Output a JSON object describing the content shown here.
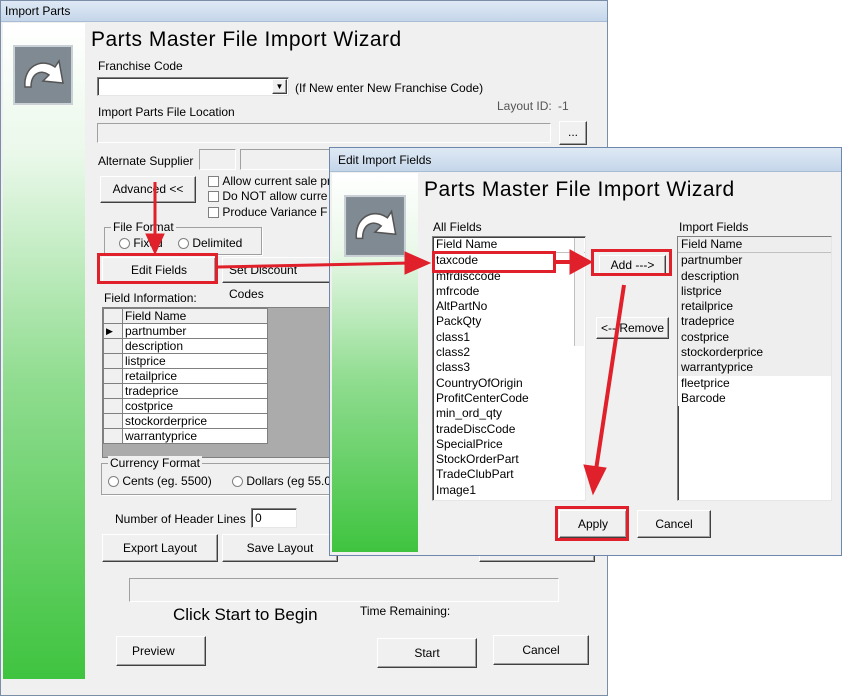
{
  "main": {
    "title": "Import Parts",
    "heading": "Parts Master File Import Wizard",
    "franchise_label": "Franchise Code",
    "franchise_hint": "(If New enter New Franchise Code)",
    "location_label": "Import Parts File Location",
    "layout_id_label": "Layout ID:",
    "layout_id_value": "-1",
    "browse_label": "...",
    "alt_supplier_label": "Alternate Supplier",
    "advanced_label": "Advanced <<",
    "checks": [
      "Allow current sale pr",
      "Do NOT allow curre",
      "Produce Variance F"
    ],
    "file_format_label": "File Format",
    "fixed_label": "Fixed",
    "delimited_label": "Delimited",
    "edit_fields_label": "Edit Fields",
    "set_discount_label": "Set Discount Codes",
    "field_info_label": "Field Information:",
    "grid_header": "Field Name",
    "grid_rows": [
      "partnumber",
      "description",
      "listprice",
      "retailprice",
      "tradeprice",
      "costprice",
      "stockorderprice",
      "warrantyprice"
    ],
    "currency_label": "Currency Format",
    "cents_label": "Cents (eg. 5500)",
    "dollars_label": "Dollars (eg 55.0",
    "header_lines_label": "Number of Header Lines",
    "header_lines_value": "0",
    "export_label": "Export Layout",
    "save_label": "Save Layout",
    "click_start": "Click Start to Begin",
    "time_remaining": "Time Remaining:",
    "preview_label": "Preview",
    "start_label": "Start",
    "cancel_label": "Cancel"
  },
  "dialog": {
    "title": "Edit Import Fields",
    "heading": "Parts Master File Import Wizard",
    "all_fields_label": "All Fields",
    "import_fields_label": "Import Fields",
    "list_header": "Field Name",
    "all_fields": [
      "taxcode",
      "mfrdisccode",
      "mfrcode",
      "AltPartNo",
      "PackQty",
      "class1",
      "class2",
      "class3",
      "CountryOfOrigin",
      "ProfitCenterCode",
      "min_ord_qty",
      "tradeDiscCode",
      "SpecialPrice",
      "StockOrderPart",
      "TradeClubPart",
      "Image1"
    ],
    "import_fields": [
      "partnumber",
      "description",
      "listprice",
      "retailprice",
      "tradeprice",
      "costprice",
      "stockorderprice",
      "warrantyprice",
      "fleetprice",
      "Barcode"
    ],
    "add_label": "Add --->",
    "remove_label": "<-- Remove",
    "apply_label": "Apply",
    "cancel_label": "Cancel"
  },
  "colors": {
    "annotation_red": "#e0202a",
    "green_panel": "#3fc43f"
  }
}
